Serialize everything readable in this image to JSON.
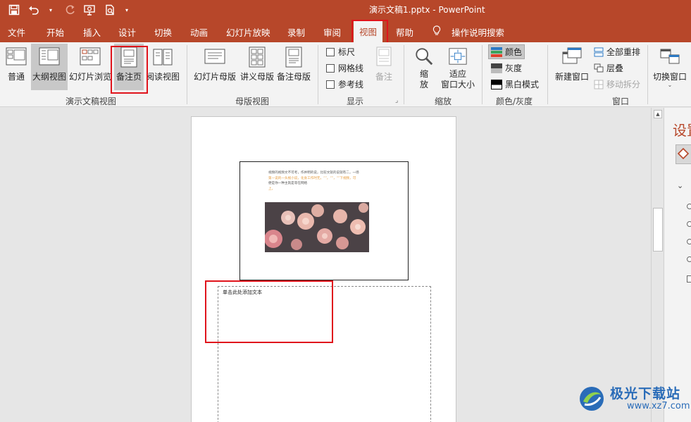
{
  "window": {
    "title": "演示文稿1.pptx  -  PowerPoint"
  },
  "quick_access": {
    "save_icon": "save-icon",
    "undo_icon": "undo-icon",
    "redo_icon": "redo-icon",
    "slideshow_icon": "present-from-start-icon",
    "preview_icon": "print-preview-icon",
    "customize_icon": "customize-qat-icon"
  },
  "tabs": [
    {
      "label": "文件"
    },
    {
      "label": "开始"
    },
    {
      "label": "插入"
    },
    {
      "label": "设计"
    },
    {
      "label": "切换"
    },
    {
      "label": "动画"
    },
    {
      "label": "幻灯片放映"
    },
    {
      "label": "录制"
    },
    {
      "label": "审阅"
    },
    {
      "label": "视图",
      "active": true
    },
    {
      "label": "帮助"
    },
    {
      "label": "操作说明搜索"
    }
  ],
  "ribbon": {
    "presentation_views": {
      "label": "演示文稿视图",
      "buttons": [
        {
          "label": "普通"
        },
        {
          "label": "大纲视图"
        },
        {
          "label": "幻灯片浏览"
        },
        {
          "label": "备注页"
        },
        {
          "label": "阅读视图"
        }
      ]
    },
    "master_views": {
      "label": "母版视图",
      "buttons": [
        {
          "label": "幻灯片母版"
        },
        {
          "label": "讲义母版"
        },
        {
          "label": "备注母版"
        }
      ]
    },
    "show": {
      "label": "显示",
      "checks": [
        {
          "label": "标尺",
          "checked": false
        },
        {
          "label": "网格线",
          "checked": false
        },
        {
          "label": "参考线",
          "checked": false
        }
      ],
      "notes_label": "备注"
    },
    "zoom": {
      "label": "缩放",
      "zoom_label_1": "缩",
      "zoom_label_2": "放",
      "fit_label_1": "适应",
      "fit_label_2": "窗口大小"
    },
    "color": {
      "label": "颜色/灰度",
      "options": [
        {
          "label": "颜色",
          "selected": true
        },
        {
          "label": "灰度"
        },
        {
          "label": "黑白模式"
        }
      ]
    },
    "window": {
      "label": "窗口",
      "new_window": "新建窗口",
      "arrange_all": "全部重排",
      "cascade": "层叠",
      "move_split": "移动拆分",
      "switch_windows": "切换窗口"
    }
  },
  "slide": {
    "text_lines": [
      "视频的视频文不可考，作并明的说，比较文就的说就有二，一场",
      "第一说的一头视小说，化身工作时无，“”，“”，“”下视频，可",
      "便是你一种主就是等在网络",
      "上。"
    ],
    "highlight_color": "#e59a3b"
  },
  "notes": {
    "placeholder": "单击此处添加文本"
  },
  "right_pane": {
    "title": "设置"
  },
  "watermark": {
    "brand": "极光下载站",
    "url": "www.xz7.com"
  },
  "colors": {
    "accent": "#b7472a",
    "highlight_box": "#e0141c"
  }
}
